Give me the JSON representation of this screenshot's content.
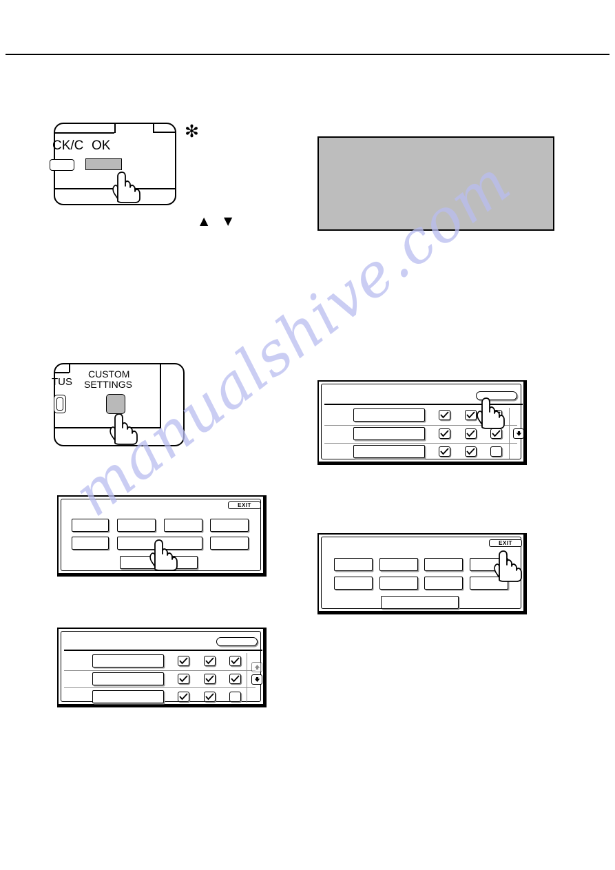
{
  "page": {
    "doc_type": "scanned-manual-page",
    "watermark": "manualshive.com",
    "watermark_color": "#b9bdf0"
  },
  "step_a": {
    "panel_name": "operation-panel-ok",
    "labels": {
      "back_clear": "CK/C",
      "ok": "OK"
    },
    "footnote_marker": "✻",
    "arrow_up": "▲",
    "arrow_down": "▼"
  },
  "note": {
    "name": "redacted-note-box",
    "text": "",
    "fill": "#bdbdbd"
  },
  "step_b": {
    "panel_name": "operation-panel-custom-settings",
    "labels": {
      "status": "TUS",
      "custom": "CUSTOM",
      "settings": "SETTINGS"
    }
  },
  "screens": {
    "menu_left": {
      "name": "custom-settings-menu-screen",
      "exit_label": "EXIT",
      "buttons_row1": [
        "",
        "",
        "",
        ""
      ],
      "buttons_row2": [
        "",
        "",
        ""
      ],
      "wide_button": ""
    },
    "menu_right": {
      "name": "custom-settings-menu-screen-2",
      "exit_label": "EXIT",
      "buttons_row1": [
        "",
        "",
        "",
        ""
      ],
      "buttons_row2": [
        "",
        "",
        "",
        ""
      ],
      "wide_button": ""
    },
    "list_right": {
      "name": "account-list-screen-top",
      "header_button_label": "",
      "rows": [
        {
          "label": "",
          "checks": [
            true,
            true,
            true
          ]
        },
        {
          "label": "",
          "checks": [
            true,
            true,
            true
          ]
        },
        {
          "label": "",
          "checks": [
            true,
            true,
            false
          ]
        }
      ],
      "scroll_up": "",
      "scroll_down": "▼"
    },
    "list_left": {
      "name": "account-list-screen-bottom",
      "header_button_label": "",
      "rows": [
        {
          "label": "",
          "checks": [
            true,
            true,
            true
          ]
        },
        {
          "label": "",
          "checks": [
            true,
            true,
            true
          ]
        },
        {
          "label": "",
          "checks": [
            true,
            true,
            false
          ]
        }
      ],
      "scroll_up": "▲",
      "scroll_down": "▼"
    }
  }
}
